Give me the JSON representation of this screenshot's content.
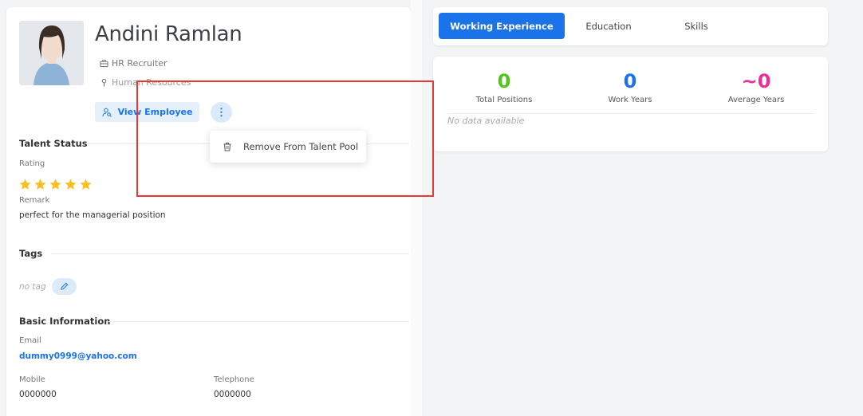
{
  "profile": {
    "name": "Andini Ramlan",
    "role": "HR Recruiter",
    "department": "Human Resources",
    "view_employee_label": "View Employee"
  },
  "dropdown": {
    "remove_label": "Remove From Talent Pool"
  },
  "talent_status": {
    "title": "Talent Status",
    "rating_label": "Rating",
    "rating": 5,
    "rating_max": 5,
    "remark_label": "Remark",
    "remark_value": "perfect for the managerial position"
  },
  "tags": {
    "title": "Tags",
    "empty_text": "no tag"
  },
  "basic_info": {
    "title": "Basic Information",
    "email_label": "Email",
    "email_value": "dummy0999@yahoo.com",
    "mobile_label": "Mobile",
    "mobile_value": "0000000",
    "telephone_label": "Telephone",
    "telephone_value": "0000000"
  },
  "tabs": [
    {
      "label": "Working Experience",
      "active": true
    },
    {
      "label": "Education",
      "active": false
    },
    {
      "label": "Skills",
      "active": false
    }
  ],
  "stats": [
    {
      "value": "0",
      "caption": "Total Positions",
      "color": "#52c41a"
    },
    {
      "value": "0",
      "caption": "Work Years",
      "color": "#1a73e8"
    },
    {
      "value": "~0",
      "caption": "Average Years",
      "color": "#eb2f96"
    }
  ],
  "experience": {
    "empty_text": "No data available"
  },
  "colors": {
    "accent": "#1a73e8",
    "star": "#fbbf24",
    "highlight": "#e53935"
  }
}
